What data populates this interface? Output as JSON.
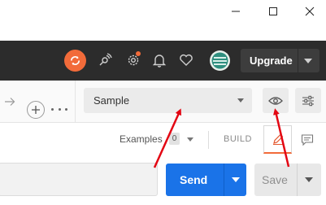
{
  "header": {
    "upgrade_label": "Upgrade"
  },
  "environment": {
    "selected": "Sample"
  },
  "examples": {
    "label": "Examples",
    "count": "0",
    "build_label": "BUILD"
  },
  "request": {
    "send_label": "Send",
    "save_label": "Save"
  },
  "colors": {
    "accent_orange": "#f26b3a",
    "send_blue": "#1a73e8",
    "annotation_red": "#e30613",
    "header_dark": "#2c2c2c"
  },
  "icons": [
    "minimize-icon",
    "maximize-icon",
    "close-icon",
    "sync-icon",
    "satellite-icon",
    "settings-gear-icon",
    "bell-icon",
    "heart-icon",
    "avatar",
    "chevron-right-icon",
    "plus-icon",
    "more-icon",
    "eye-icon",
    "sliders-icon",
    "pencil-icon",
    "comment-icon"
  ]
}
